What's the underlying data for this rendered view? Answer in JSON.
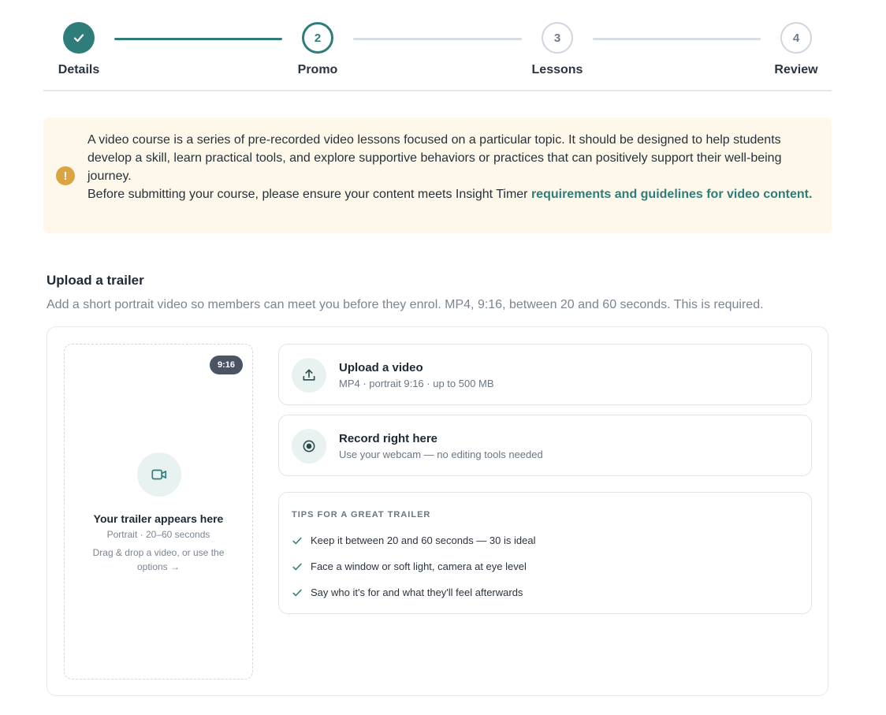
{
  "stepper": {
    "steps": [
      {
        "label": "Details",
        "number": "1",
        "state": "done"
      },
      {
        "label": "Promo",
        "number": "2",
        "state": "current"
      },
      {
        "label": "Lessons",
        "number": "3",
        "state": "todo"
      },
      {
        "label": "Review",
        "number": "4",
        "state": "todo"
      }
    ]
  },
  "notice": {
    "icon": "exclamation-icon",
    "text_line1": "A video course is a series of pre-recorded video lessons focused on a particular topic. It should be designed to help students develop a skill, learn practical tools, and explore supportive behaviors or practices that can positively support their well-being journey.",
    "text_line2": "Before submitting your course, please ensure your content meets Insight Timer ",
    "link_text": "requirements and guidelines for video content."
  },
  "upload": {
    "title": "Upload a trailer",
    "description": "Add a short portrait video so members can meet you before they enrol. MP4, 9:16, between 20 and 60 seconds. This is required.",
    "preview": {
      "ratio_badge": "9:16",
      "title": "Your trailer appears here",
      "subtitle": "Portrait · 20–60 seconds",
      "hint": "Drag & drop a video, or use the options →"
    },
    "options": [
      {
        "title": "Upload a video",
        "subtitle": "MP4 · portrait 9:16 · up to 500 MB",
        "icon": "upload-icon"
      },
      {
        "title": "Record right here",
        "subtitle": "Use your webcam — no editing tools needed",
        "icon": "record-icon"
      }
    ],
    "tips": {
      "heading": "TIPS FOR A GREAT TRAILER",
      "items": [
        "Keep it between 20 and 60 seconds — 30 is ideal",
        "Face a window or soft light, camera at eye level",
        "Say who it's for and what they'll feel afterwards"
      ]
    }
  },
  "colors": {
    "accent": "#2f7d7b",
    "notice_bg": "#fdf8ea",
    "warning": "#d9a441"
  }
}
